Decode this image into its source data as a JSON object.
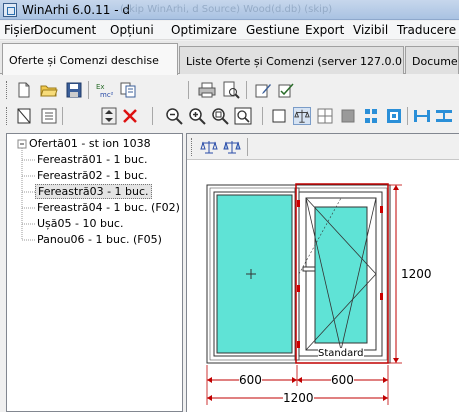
{
  "window": {
    "title": "WinArhi 6.0.11 - d",
    "ghost_text": "(skip WinArhi, d Source) Wood(d.db) (skip)"
  },
  "menu": [
    "Fișier",
    "Document",
    "Opțiuni",
    "Optimizare",
    "Gestiune",
    "Export",
    "Vizibil",
    "Traducere"
  ],
  "tabs": [
    {
      "label": "Oferte și Comenzi deschise"
    },
    {
      "label": "Liste Oferte și Comenzi   (server 127.0.0.1)"
    },
    {
      "label": "Documen"
    }
  ],
  "tree": {
    "root": "Ofertă01 - st ion 1038",
    "items": [
      {
        "label": "Fereastră01 - 1 buc."
      },
      {
        "label": "Fereastră02 - 1 buc."
      },
      {
        "label": "Fereastră03 - 1 buc."
      },
      {
        "label": "Fereastră04 - 1 buc. (F02)"
      },
      {
        "label": "Ușă05 - 10 buc."
      },
      {
        "label": "Panou06 - 1 buc. (F05)"
      }
    ]
  },
  "drawing": {
    "sash_label": "Standard",
    "dim_height": "1200",
    "dim_left": "600",
    "dim_right": "600",
    "dim_total": "1200",
    "colors": {
      "glass": "#5fe3d6",
      "frame": "#ffffff",
      "selection": "#c00000",
      "dimension": "#c00000",
      "hardware": "#cc0000"
    }
  },
  "toolbar_icons": {
    "row1": [
      "new-document-icon",
      "open-folder-icon",
      "save-icon",
      "calculator-icon",
      "copy-icon",
      "print-icon",
      "print-preview-icon",
      "edit-icon",
      "edit-check-icon"
    ],
    "row2": [
      "window-frame-icon",
      "dimension-icon",
      "sort-icon",
      "delete-icon",
      "zoom-out-icon",
      "zoom-in-icon",
      "zoom-window-icon",
      "zoom-fit-icon",
      "blank-icon",
      "balance-icon",
      "grid-icon",
      "fill-icon",
      "sash-split-icon",
      "frame-icon",
      "align-left-icon",
      "align-center-icon",
      "align-right-icon"
    ],
    "canvas": [
      "balance-left-icon",
      "balance-right-icon"
    ]
  }
}
